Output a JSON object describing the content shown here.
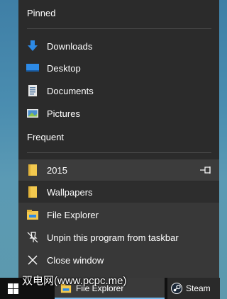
{
  "jumplist": {
    "pinned_label": "Pinned",
    "pinned": [
      {
        "label": "Downloads",
        "icon": "download-arrow-icon"
      },
      {
        "label": "Desktop",
        "icon": "desktop-icon"
      },
      {
        "label": "Documents",
        "icon": "document-icon"
      },
      {
        "label": "Pictures",
        "icon": "pictures-icon"
      }
    ],
    "frequent_label": "Frequent",
    "frequent": [
      {
        "label": "2015",
        "icon": "folder-icon",
        "pin_icon": "pin-icon"
      },
      {
        "label": "Wallpapers",
        "icon": "folder-icon"
      }
    ],
    "tasks": [
      {
        "label": "File Explorer",
        "icon": "file-explorer-icon"
      },
      {
        "label": "Unpin this program from taskbar",
        "icon": "unpin-icon"
      },
      {
        "label": "Close window",
        "icon": "close-icon"
      }
    ]
  },
  "taskbar": {
    "start_icon": "windows-logo-icon",
    "explorer_label": "File Explorer",
    "steam_label": "Steam"
  },
  "watermark": "双电网(www.pcpc.me)",
  "colors": {
    "menu_bg": "#2b2b2b",
    "tasks_bg": "#383838",
    "folder_yellow": "#f3c94e",
    "accent_blue": "#2d8ae6",
    "taskbar_bg": "#101010"
  }
}
